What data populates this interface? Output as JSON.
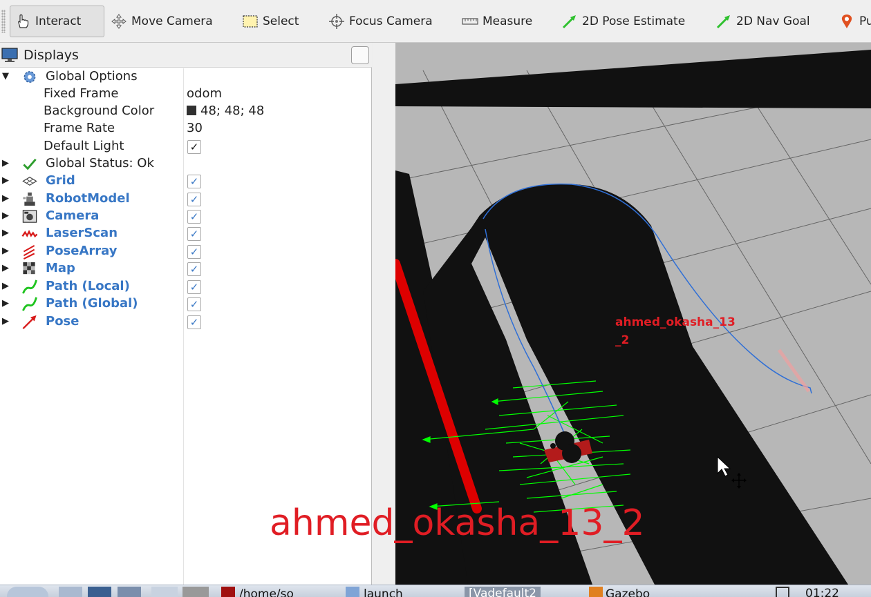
{
  "toolbar": {
    "tools": [
      {
        "label": "Interact",
        "icon": "hand-pointer-icon"
      },
      {
        "label": "Move Camera",
        "icon": "move-camera-icon"
      },
      {
        "label": "Select",
        "icon": "select-box-icon"
      },
      {
        "label": "Focus Camera",
        "icon": "focus-camera-icon"
      },
      {
        "label": "Measure",
        "icon": "ruler-icon"
      },
      {
        "label": "2D Pose Estimate",
        "icon": "green-arrow-icon"
      },
      {
        "label": "2D Nav Goal",
        "icon": "green-arrow-icon"
      },
      {
        "label": "Pu",
        "icon": "map-pin-icon"
      }
    ]
  },
  "displays": {
    "title": "Displays",
    "global_options": {
      "label": "Global Options",
      "props": [
        {
          "name": "Fixed Frame",
          "value": "odom"
        },
        {
          "name": "Background Color",
          "value": "48; 48; 48",
          "swatch": "#303030"
        },
        {
          "name": "Frame Rate",
          "value": "30"
        },
        {
          "name": "Default Light",
          "value": "✓"
        }
      ]
    },
    "global_status": "Global Status: Ok",
    "items": [
      {
        "label": "Grid",
        "icon": "grid-icon",
        "checked": "✓"
      },
      {
        "label": "RobotModel",
        "icon": "robot-model-icon",
        "checked": "✓"
      },
      {
        "label": "Camera",
        "icon": "camera-icon",
        "checked": "✓"
      },
      {
        "label": "LaserScan",
        "icon": "laser-scan-icon",
        "checked": "✓"
      },
      {
        "label": "PoseArray",
        "icon": "pose-array-icon",
        "checked": "✓"
      },
      {
        "label": "Map",
        "icon": "map-icon",
        "checked": "✓"
      },
      {
        "label": "Path (Local)",
        "icon": "path-icon",
        "checked": "✓"
      },
      {
        "label": "Path (Global)",
        "icon": "path-icon",
        "checked": "✓"
      },
      {
        "label": "Pose",
        "icon": "pose-arrow-icon",
        "checked": "✓"
      }
    ]
  },
  "scene": {
    "robot_label": "ahmed_okasha_13\n_2",
    "robot_label_line1": "ahmed_okasha_13",
    "robot_label_line2": "_2"
  },
  "watermark": "ahmed_okasha_13_2",
  "taskbar": {
    "items": [
      "/home/so",
      "launch",
      "[Vadefault2",
      "Gazebo",
      "01:22"
    ]
  },
  "colors": {
    "display_label": "#3877c5",
    "watermark": "#e01d24",
    "floor": "#b7b7b7",
    "walls": "#111111",
    "laser": "#dd0000",
    "pose_array": "#00ff00",
    "path": "#2f6fd6"
  }
}
